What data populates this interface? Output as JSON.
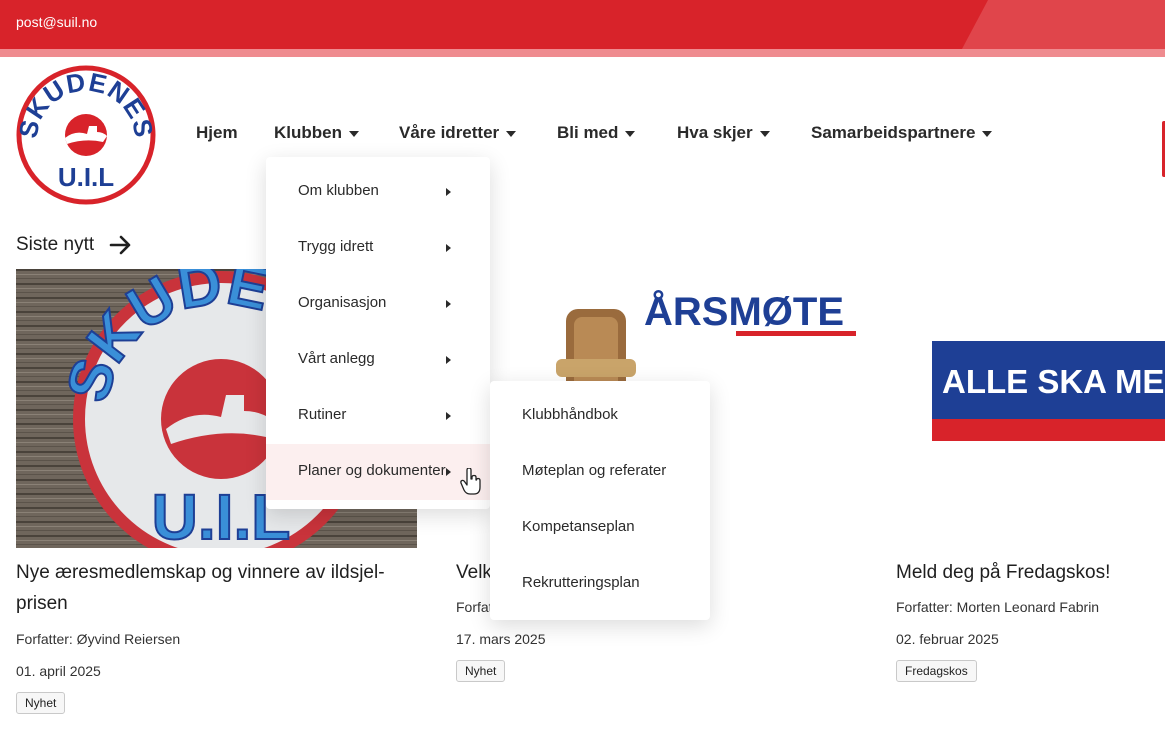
{
  "topbar": {
    "email": "post@suil.no"
  },
  "logo": {
    "alt_name": "Skudenes U.I.L",
    "ring_text": "SKUDENES",
    "bottom_text": "U.I.L"
  },
  "nav": {
    "items": [
      {
        "label": "Hjem",
        "has_caret": false
      },
      {
        "label": "Klubben",
        "has_caret": true
      },
      {
        "label": "Våre idretter",
        "has_caret": true
      },
      {
        "label": "Bli med",
        "has_caret": true
      },
      {
        "label": "Hva skjer",
        "has_caret": true
      },
      {
        "label": "Samarbeidspartnere",
        "has_caret": true
      }
    ]
  },
  "dropdown_klubben": {
    "items": [
      {
        "label": "Om klubben"
      },
      {
        "label": "Trygg idrett"
      },
      {
        "label": "Organisasjon"
      },
      {
        "label": "Vårt anlegg"
      },
      {
        "label": "Rutiner"
      },
      {
        "label": "Planer og dokumenter",
        "active": true
      }
    ]
  },
  "dropdown_planer": {
    "items": [
      {
        "label": "Klubbhåndbok"
      },
      {
        "label": "Møteplan og referater"
      },
      {
        "label": "Kompetanseplan"
      },
      {
        "label": "Rekrutteringsplan"
      }
    ]
  },
  "news": {
    "heading": "Siste nytt",
    "cards": [
      {
        "title_line1": "Nye æresmedlemskap og vinnere av ildsjel-",
        "title_line2": "prisen",
        "author": "Forfatter: Øyvind Reiersen",
        "date": "01. april 2025",
        "tag": "Nyhet"
      },
      {
        "title_line1": "Velk",
        "author": "Forfat",
        "date": "17. mars 2025",
        "tag": "Nyhet",
        "image_text": "ÅRSMØTE"
      },
      {
        "title_line1": "Meld deg på Fredagskos!",
        "author": "Forfatter: Morten Leonard Fabrin",
        "date": "02. februar 2025",
        "tag": "Fredagskos",
        "image_text": "ALLE SKA ME"
      }
    ]
  },
  "colors": {
    "brand_red": "#d8232a",
    "brand_blue": "#1e3f95",
    "sky_blue": "#3a8fd8"
  },
  "icons": {
    "arrow": "arrow-right-icon",
    "caret": "caret-down-icon",
    "submenu": "caret-right-icon",
    "cursor": "hand-pointer-icon"
  }
}
